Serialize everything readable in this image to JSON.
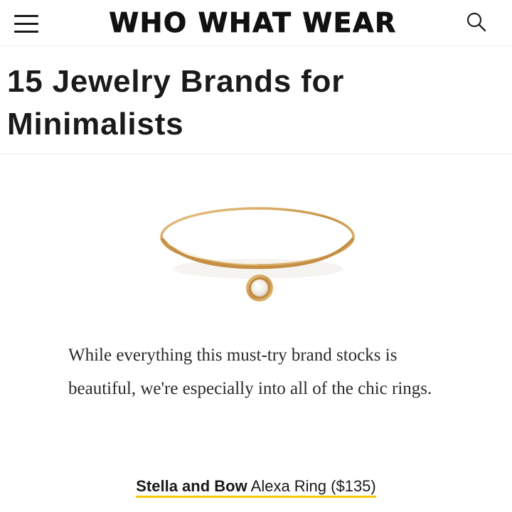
{
  "header": {
    "logo_text": "WHO WHAT WEAR",
    "menu_icon": "hamburger-menu-icon",
    "search_icon": "search-icon"
  },
  "article": {
    "title": "15 Jewelry Brands for Minimalists",
    "body": "While everything this must-try brand stocks is beautiful, we're especially into all of the chic rings.",
    "product_image": "gold-ring-with-opal-stone",
    "caption": {
      "brand": "Stella and Bow",
      "product": "Alexa Ring ($135)"
    }
  },
  "colors": {
    "text": "#1a1a1a",
    "link_underline": "#f5c800",
    "ring_gold": "#d4a85a",
    "divider": "#ececec"
  }
}
